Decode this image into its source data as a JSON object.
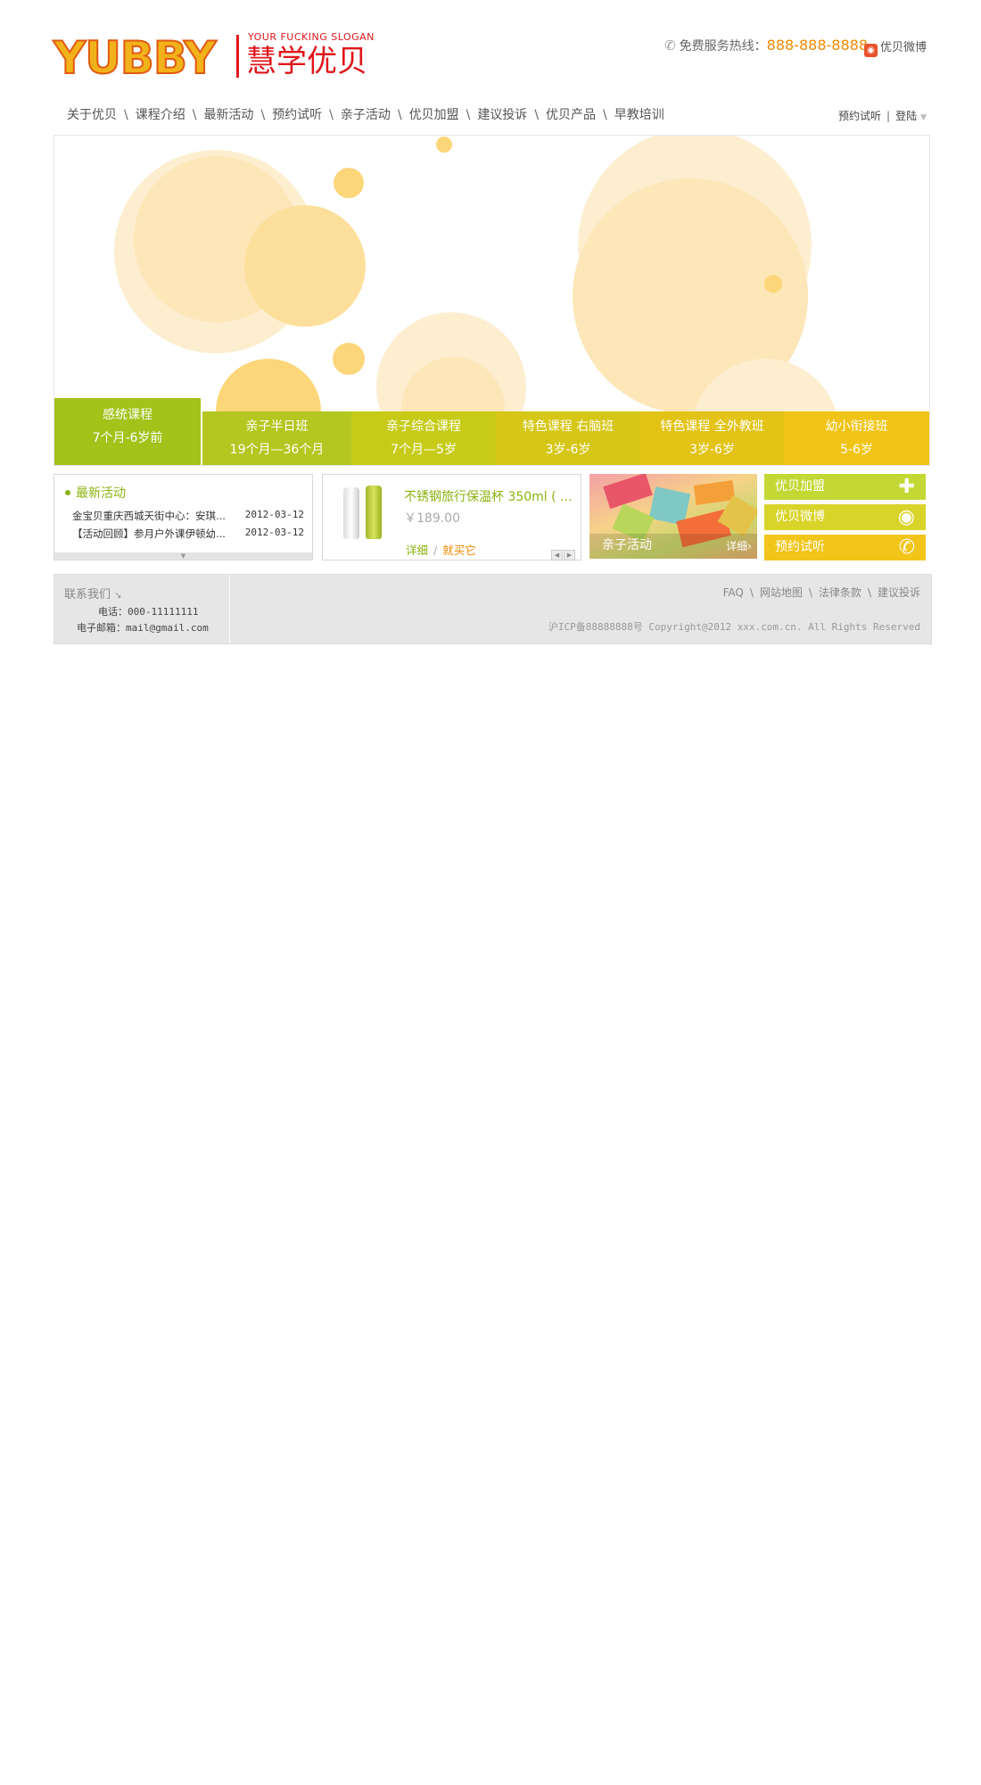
{
  "header": {
    "logo_word": "YUBBY",
    "slogan": "YOUR FUCKING SLOGAN",
    "logo_cn": "慧学优贝",
    "hotline_label": "免费服务热线：",
    "hotline_number": "888-888-8888",
    "weibo_label": "优贝微博",
    "icons": {
      "phone": "phone-icon",
      "weibo": "weibo-icon"
    }
  },
  "nav": {
    "items": [
      "关于优贝",
      "课程介绍",
      "最新活动",
      "预约试听",
      "亲子活动",
      "优贝加盟",
      "建议投诉",
      "优贝产品",
      "早教培训"
    ],
    "separator": "\\",
    "right": {
      "trial": "预约试听",
      "divider": "|",
      "login": "登陆"
    }
  },
  "banner": {
    "tabs": [
      {
        "line1": "感统课程",
        "line2": "7个月-6岁前",
        "color": "#a3c21a"
      },
      {
        "line1": "亲子半日班",
        "line2": "19个月—36个月",
        "color": "#b3c720"
      },
      {
        "line1": "亲子综合课程",
        "line2": "7个月—5岁",
        "color": "#c7cb18"
      },
      {
        "line1": "特色课程 右脑班",
        "line2": "3岁-6岁",
        "color": "#d6c616"
      },
      {
        "line1": "特色课程 全外教班",
        "line2": "3岁-6岁",
        "color": "#e2c316"
      },
      {
        "line1": "幼小衔接班",
        "line2": "5-6岁",
        "color": "#f0c414"
      }
    ]
  },
  "news": {
    "title": "最新活动",
    "items": [
      {
        "text": "金宝贝重庆西城天街中心：安琪...",
        "date": "2012-03-12"
      },
      {
        "text": "【活动回顾】参月户外课伊顿幼...",
        "date": "2012-03-12"
      }
    ]
  },
  "product": {
    "name": "不锈钢旅行保温杯 350ml ( ...",
    "price": "￥189.00",
    "detail_label": "详细",
    "slash": "/",
    "buy_label": "就买它"
  },
  "activity": {
    "title": "亲子活动",
    "more": "详细"
  },
  "side_buttons": [
    {
      "label": "优贝加盟",
      "icon": "join-icon",
      "color": "#c3d834"
    },
    {
      "label": "优贝微博",
      "icon": "weibo-icon",
      "color": "#d9d42a"
    },
    {
      "label": "预约试听",
      "icon": "phone-icon",
      "color": "#f2c51a"
    }
  ],
  "footer": {
    "contact_title": "联系我们",
    "phone": "电话：000-11111111",
    "email": "电子邮箱：mail@gmail.com",
    "links": [
      "FAQ",
      "网站地图",
      "法律条款",
      "建议投诉"
    ],
    "copyright": "沪ICP备88888888号 Copyright@2012 xxx.com.cn. All Rights Reserved"
  }
}
